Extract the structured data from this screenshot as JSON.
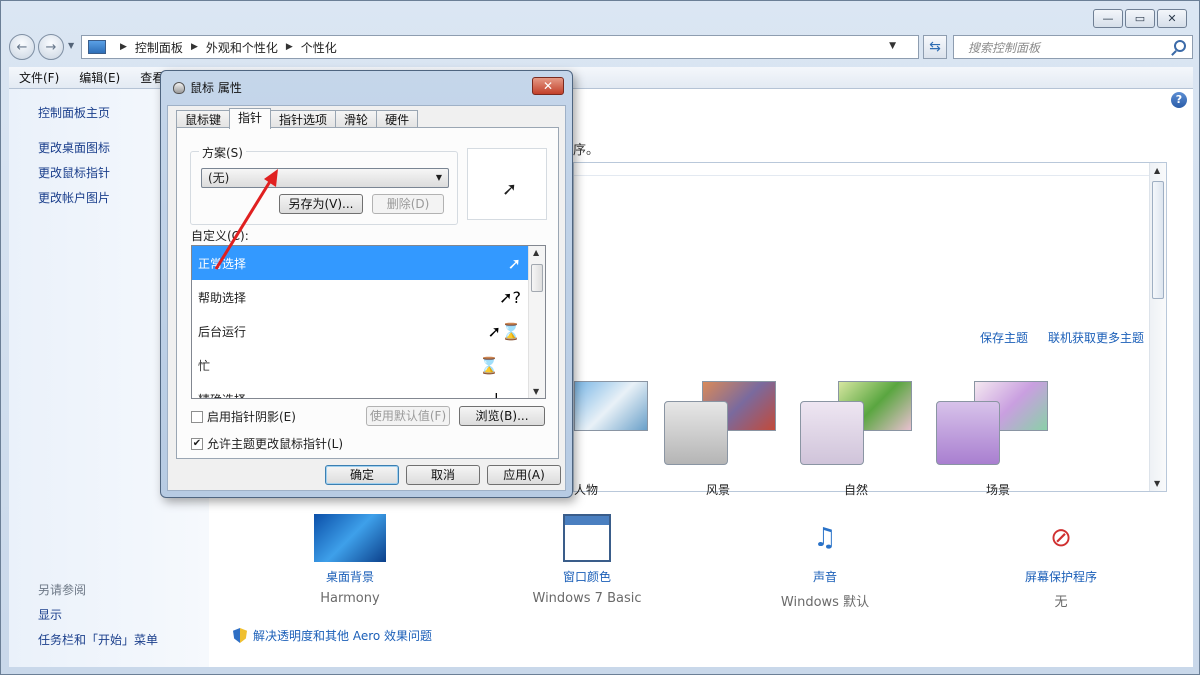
{
  "window": {
    "caption_buttons": [
      "—",
      "▭",
      "✕"
    ]
  },
  "nav": {
    "back": "←",
    "forward": "→",
    "breadcrumbs": [
      "控制面板",
      "外观和个性化",
      "个性化"
    ],
    "search_placeholder": "搜索控制面板"
  },
  "menu": [
    "文件(F)",
    "编辑(E)",
    "查看(V)"
  ],
  "left_pane": {
    "home": "控制面板主页",
    "links": [
      "更改桌面图标",
      "更改鼠标指针",
      "更改帐户图片"
    ],
    "see_also_label": "另请参阅",
    "see_also": [
      "显示",
      "任务栏和「开始」菜单"
    ]
  },
  "main": {
    "fragment": "序。",
    "help": "?",
    "save_theme": "保存主题",
    "more_themes": "联机获取更多主题",
    "themes": [
      {
        "name": "人物",
        "color": "#6aa7d8"
      },
      {
        "name": "风景",
        "color": "#c9c9c9"
      },
      {
        "name": "自然",
        "color": "#d9cfe3"
      },
      {
        "name": "场景",
        "color": "#b99ad6"
      }
    ],
    "bottom_items": [
      {
        "title": "桌面背景",
        "sub": "Harmony"
      },
      {
        "title": "窗口颜色",
        "sub": "Windows 7 Basic"
      },
      {
        "title": "声音",
        "sub": "Windows 默认"
      },
      {
        "title": "屏幕保护程序",
        "sub": "无"
      }
    ],
    "aero_link": "解决透明度和其他 Aero 效果问题"
  },
  "dialog": {
    "title": "鼠标 属性",
    "close": "✕",
    "tabs": [
      "鼠标键",
      "指针",
      "指针选项",
      "滑轮",
      "硬件"
    ],
    "active_tab": 1,
    "scheme_label": "方案(S)",
    "scheme_value": "(无)",
    "save_as": "另存为(V)...",
    "delete": "删除(D)",
    "custom_label": "自定义(C):",
    "pointers": [
      {
        "label": "正常选择",
        "cursor": "➚"
      },
      {
        "label": "帮助选择",
        "cursor": "➚?"
      },
      {
        "label": "后台运行",
        "cursor": "➚⌛"
      },
      {
        "label": "忙",
        "cursor": "⌛"
      },
      {
        "label": "精确选择",
        "cursor": "|"
      }
    ],
    "shadow_label": "启用指针阴影(E)",
    "shadow_checked": false,
    "use_default": "使用默认值(F)",
    "browse": "浏览(B)...",
    "allow_theme_label": "允许主题更改鼠标指针(L)",
    "allow_theme_checked": true,
    "ok": "确定",
    "cancel": "取消",
    "apply": "应用(A)"
  },
  "colors": {
    "selection": "#3399ff",
    "link": "#1b5fb8",
    "annotation_arrow": "#e02020"
  }
}
